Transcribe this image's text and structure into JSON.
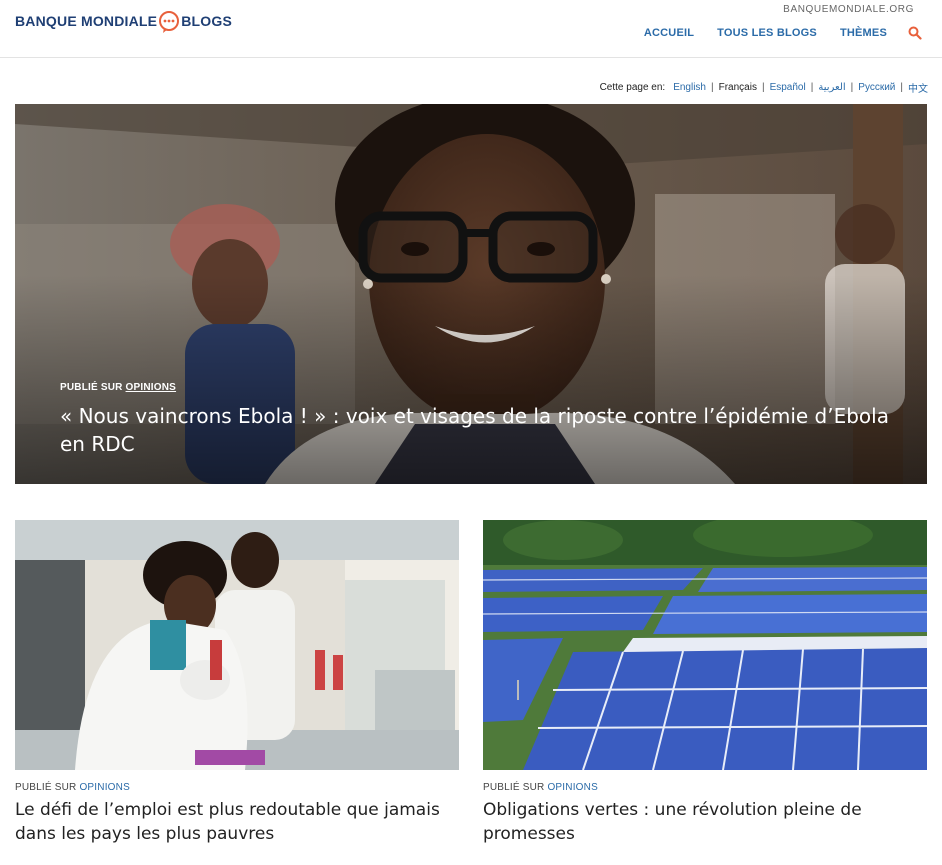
{
  "header": {
    "logo_left": "BANQUE MONDIALE",
    "logo_right": "BLOGS",
    "site_link": "BANQUEMONDIALE.ORG",
    "nav": [
      "ACCUEIL",
      "TOUS LES BLOGS",
      "THÈMES"
    ],
    "colors": {
      "brand": "#1f3f74",
      "accent": "#e8603c",
      "link": "#2b6ba8"
    }
  },
  "language_bar": {
    "label": "Cette page en:",
    "languages": [
      "English",
      "Français",
      "Español",
      "العربية",
      "Русский",
      "中文"
    ],
    "current": "Français"
  },
  "hero": {
    "published_prefix": "PUBLIÉ SUR ",
    "published_link": "OPINIONS",
    "title": "« Nous vaincrons Ebola ! » : voix et visages de la riposte contre l’épidémie d’Ebola en RDC"
  },
  "cards": [
    {
      "published_prefix": "PUBLIÉ SUR ",
      "published_link": "OPINIONS",
      "title": "Le défi de l’emploi est plus redoutable que jamais dans les pays les plus pauvres"
    },
    {
      "published_prefix": "PUBLIÉ SUR ",
      "published_link": "OPINIONS",
      "title": "Obligations vertes : une révolution pleine de promesses"
    }
  ]
}
